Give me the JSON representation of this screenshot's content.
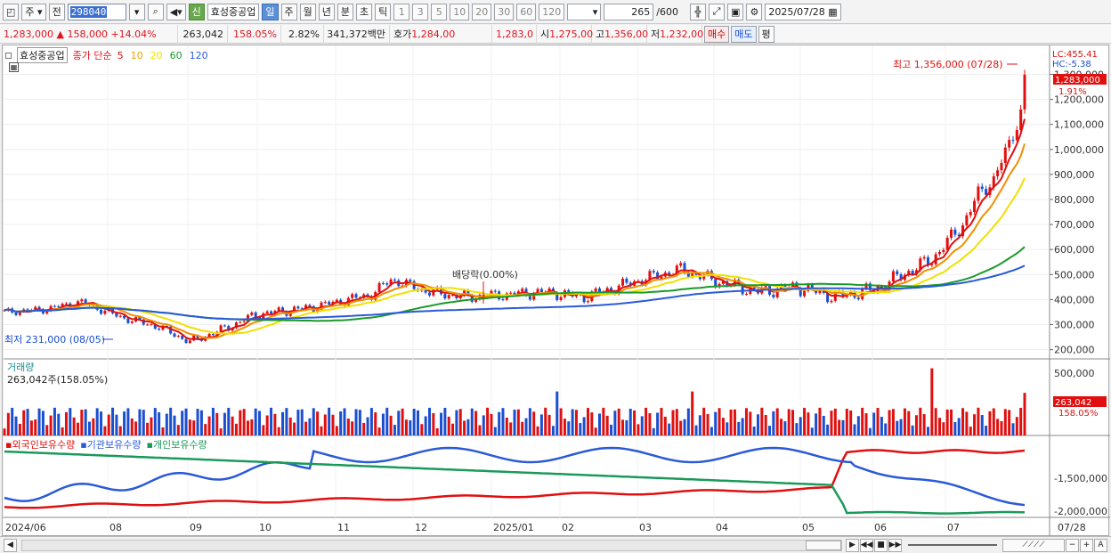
{
  "toolbar": {
    "type_select": "주",
    "prev_label": "전",
    "code": "298040",
    "new_badge": "신",
    "stock_name": "효성중공업",
    "periods": [
      "일",
      "주",
      "월",
      "년",
      "분",
      "초",
      "틱"
    ],
    "active_period": "일",
    "intervals": [
      "1",
      "3",
      "5",
      "10",
      "20",
      "30",
      "60",
      "120"
    ],
    "count": "265",
    "count_max": "/600",
    "date": "2025/07/28"
  },
  "quote": {
    "price": "1,283,000",
    "arrow": "▲",
    "change": "158,000",
    "change_pct": "+14.04%",
    "volume": "263,042",
    "volume_pct": "158.05%",
    "turnover": "2.82%",
    "amount": "341,372백만",
    "hoga_label": "호가",
    "ask": "1,284,00",
    "bid": "1,283,0",
    "open_label": "시",
    "open": "1,275,00",
    "high_label": "고",
    "high": "1,356,00",
    "low_label": "저",
    "low": "1,232,00",
    "buy": "매수",
    "sell": "매도",
    "avg": "평"
  },
  "price_panel": {
    "legend_name": "효성중공업",
    "legend_prefix": "종가 단순",
    "ma": [
      {
        "label": "5",
        "color": "#e01010"
      },
      {
        "label": "10",
        "color": "#f0a000"
      },
      {
        "label": "20",
        "color": "#f0e000"
      },
      {
        "label": "60",
        "color": "#1a9a2a"
      },
      {
        "label": "120",
        "color": "#2a5ad8"
      }
    ],
    "lc": "LC:455.41",
    "hc": "HC:-5.38",
    "last_price": "1,283,000",
    "last_pct": "1.91%",
    "high_note": "최고 1,356,000 (07/28)",
    "low_note": "최저 231,000 (08/05)",
    "dividend_note": "배당락(0.00%)",
    "yaxis": [
      "1,300,000",
      "1,200,000",
      "1,100,000",
      "1,000,000",
      "900,000",
      "800,000",
      "700,000",
      "600,000",
      "500,000",
      "400,000",
      "300,000",
      "200,000"
    ]
  },
  "volume_panel": {
    "title": "거래량",
    "value": "263,042주(158.05%)",
    "yaxis": [
      "500,000"
    ],
    "last": "263,042",
    "last_pct": "158.05%"
  },
  "holding_panel": {
    "legend": [
      "외국인보유수량",
      "기관보유수량",
      "개인보유수량"
    ],
    "colors": [
      "#e01010",
      "#2a5ad8",
      "#1a9a5a"
    ],
    "yaxis": [
      "-1,500,000",
      "-2,000,000"
    ]
  },
  "xaxis": [
    "2024/06",
    "08",
    "09",
    "10",
    "11",
    "12",
    "2025/01",
    "02",
    "03",
    "04",
    "05",
    "06",
    "07",
    "07/28"
  ],
  "chart_data": {
    "type": "line",
    "title": "효성중공업",
    "x": [
      "2024/06",
      "08",
      "09",
      "10",
      "11",
      "12",
      "2025/01",
      "02",
      "03",
      "04",
      "05",
      "06",
      "07",
      "07/28"
    ],
    "series": [
      {
        "name": "5",
        "values": [
          350000,
          300000,
          270000,
          360000,
          480000,
          430000,
          420000,
          520000,
          430000,
          410000,
          490000,
          650000,
          880000,
          1283000
        ]
      },
      {
        "name": "120",
        "values": [
          270000,
          300000,
          320000,
          330000,
          360000,
          380000,
          390000,
          410000,
          430000,
          440000,
          450000,
          480000,
          540000,
          620000
        ]
      }
    ],
    "ylim": [
      170000,
      1380000
    ]
  }
}
